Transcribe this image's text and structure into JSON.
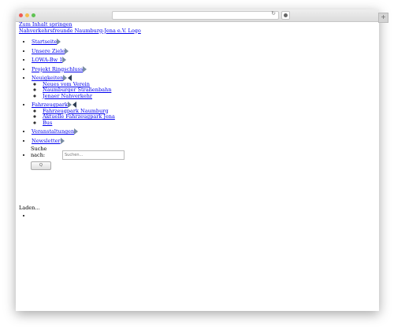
{
  "browser": {
    "reload_glyph": "↻",
    "ext_icon": "record-icon",
    "newtab_glyph": "+"
  },
  "page": {
    "skip_link": "Zum Inhalt springen",
    "logo_link": "Nahverkehrsfreunde Naumburg-Jena e.V. Logo",
    "menu": [
      {
        "label": "Startseite"
      },
      {
        "label": "Unsere Ziele"
      },
      {
        "label": "LOWA-Bw 1"
      },
      {
        "label": "Projekt Ringschluss"
      },
      {
        "label": "Neuigkeiten",
        "sub": [
          "Neues vom Verein",
          "Naumburger Straßenbahn",
          "Jenaer Nahverkehr"
        ]
      },
      {
        "label": "Fahrzeugpark",
        "sub": [
          "Fahrzeugpark Naumburg",
          "Aktuelle Fahrzeugpark Jena",
          "Bus"
        ]
      },
      {
        "label": "Veranstaltungen"
      },
      {
        "label": "Newsletter"
      }
    ],
    "search": {
      "label": "Suche nach:",
      "placeholder": "Suchen...",
      "button": "Q"
    },
    "loading": "Laden..."
  }
}
